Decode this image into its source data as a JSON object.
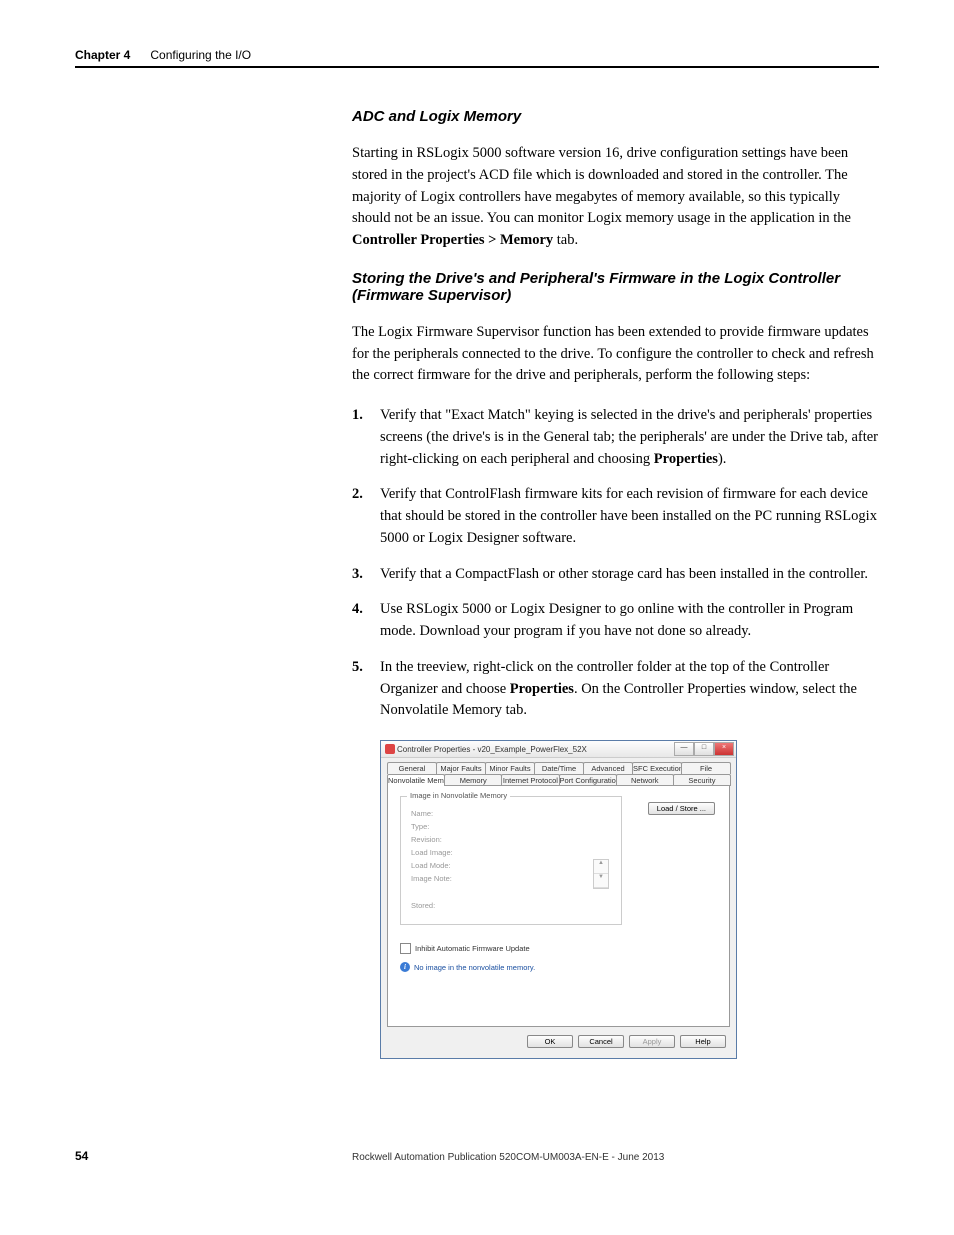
{
  "header": {
    "chapter": "Chapter 4",
    "title": "Configuring the I/O"
  },
  "section1": {
    "heading": "ADC and Logix Memory",
    "para": "Starting in RSLogix 5000 software version 16, drive configuration settings have been stored in the project's ACD file which is downloaded and stored in the controller. The majority of Logix controllers have megabytes of memory available, so this typically should not be an issue. You can monitor Logix memory usage in the application in the ",
    "para_bold": "Controller Properties > Memory",
    "para_tail": " tab."
  },
  "section2": {
    "heading": "Storing the Drive's and Peripheral's Firmware in the Logix Controller (Firmware Supervisor)",
    "para": "The Logix Firmware Supervisor function has been extended to provide firmware updates for the peripherals connected to the drive. To configure the controller to check and refresh the correct firmware for the drive and peripherals, perform the following steps:"
  },
  "steps": {
    "s1a": "Verify that \"Exact Match\" keying is selected in the drive's and peripherals' properties screens (the drive's is in the General tab; the peripherals' are under the Drive tab, after right-clicking on each peripheral and choosing ",
    "s1b": "Properties",
    "s1c": ").",
    "s2": "Verify that ControlFlash firmware kits for each revision of firmware for each device that should be stored in the controller have been installed on the PC running RSLogix 5000 or Logix Designer software.",
    "s3": "Verify that a CompactFlash or other storage card has been installed in the controller.",
    "s4": "Use RSLogix 5000 or Logix Designer to go online with the controller in Program mode.  Download your program if you have not done so already.",
    "s5a": "In the treeview, right-click on the controller folder at the top of the Controller Organizer and choose ",
    "s5b": "Properties",
    "s5c": ". On the Controller Properties window, select the Nonvolatile Memory tab."
  },
  "dialog": {
    "title": "Controller Properties - v20_Example_PowerFlex_52X",
    "tabs_row1": [
      "General",
      "Major Faults",
      "Minor Faults",
      "Date/Time",
      "Advanced",
      "SFC Execution",
      "File"
    ],
    "tabs_row2": [
      "Nonvolatile Memory",
      "Memory",
      "Internet Protocol",
      "Port Configuration",
      "Network",
      "Security"
    ],
    "fieldset_legend": "Image in Nonvolatile Memory",
    "fields": {
      "name": "Name:",
      "type": "Type:",
      "revision": "Revision:",
      "load_image": "Load Image:",
      "load_mode": "Load Mode:",
      "image_note": "Image Note:",
      "stored": "Stored:"
    },
    "load_store": "Load / Store ...",
    "checkbox": "Inhibit Automatic Firmware Update",
    "info": "No image in the nonvolatile memory.",
    "buttons": {
      "ok": "OK",
      "cancel": "Cancel",
      "apply": "Apply",
      "help": "Help"
    }
  },
  "footer": {
    "page": "54",
    "pub": "Rockwell Automation Publication 520COM-UM003A-EN-E - June 2013"
  }
}
